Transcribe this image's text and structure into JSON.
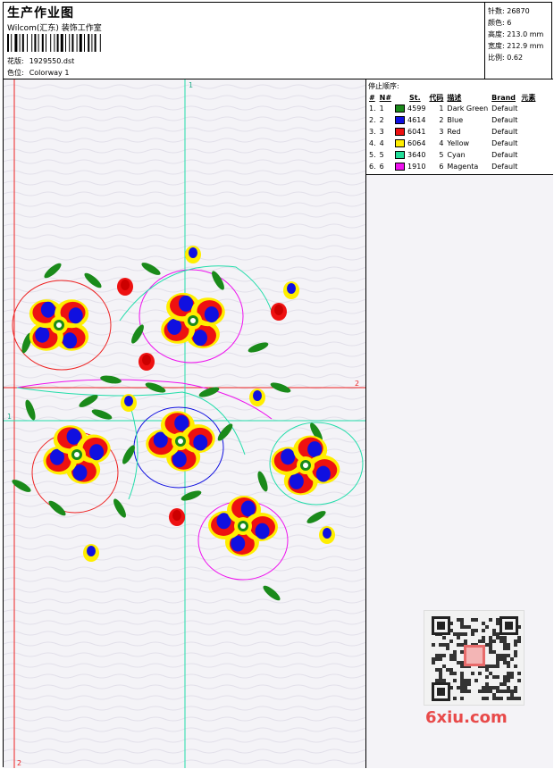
{
  "header": {
    "title": "生产作业图",
    "company": "Wilcom(汇东) 装饰工作室",
    "design_label": "花版:",
    "design_value": "1929550.dst",
    "colorway_label": "色位:",
    "colorway_value": "Colorway 1"
  },
  "stats": {
    "stitches_label": "针数:",
    "stitches_value": "26870",
    "colors_label": "颜色:",
    "colors_value": "6",
    "height_label": "高度:",
    "height_value": "213.0 mm",
    "width_label": "宽度:",
    "width_value": "212.9 mm",
    "scale_label": "比例:",
    "scale_value": "0.62"
  },
  "stop_sequence": {
    "title": "停止顺序:",
    "columns": [
      "#",
      "N#",
      "St.",
      "代码",
      "描述",
      "Brand",
      "元素"
    ],
    "rows": [
      {
        "idx": "1.",
        "n": "1",
        "color": "#1a8a1a",
        "st": "4599",
        "code": "1",
        "desc": "Dark Green",
        "brand": "Default"
      },
      {
        "idx": "2.",
        "n": "2",
        "color": "#1010e0",
        "st": "4614",
        "code": "2",
        "desc": "Blue",
        "brand": "Default"
      },
      {
        "idx": "3.",
        "n": "3",
        "color": "#ee1111",
        "st": "6041",
        "code": "3",
        "desc": "Red",
        "brand": "Default"
      },
      {
        "idx": "4.",
        "n": "4",
        "color": "#ffee00",
        "st": "6064",
        "code": "4",
        "desc": "Yellow",
        "brand": "Default"
      },
      {
        "idx": "5.",
        "n": "5",
        "color": "#22dd99",
        "st": "3640",
        "code": "5",
        "desc": "Cyan",
        "brand": "Default"
      },
      {
        "idx": "6.",
        "n": "6",
        "color": "#ee11ee",
        "st": "1910",
        "code": "6",
        "desc": "Magenta",
        "brand": "Default"
      }
    ]
  },
  "guides": {
    "top_marker": "1",
    "left_marker": "1",
    "right_marker": "2",
    "bottom_marker": "2"
  },
  "watermark": "6xiu.com"
}
